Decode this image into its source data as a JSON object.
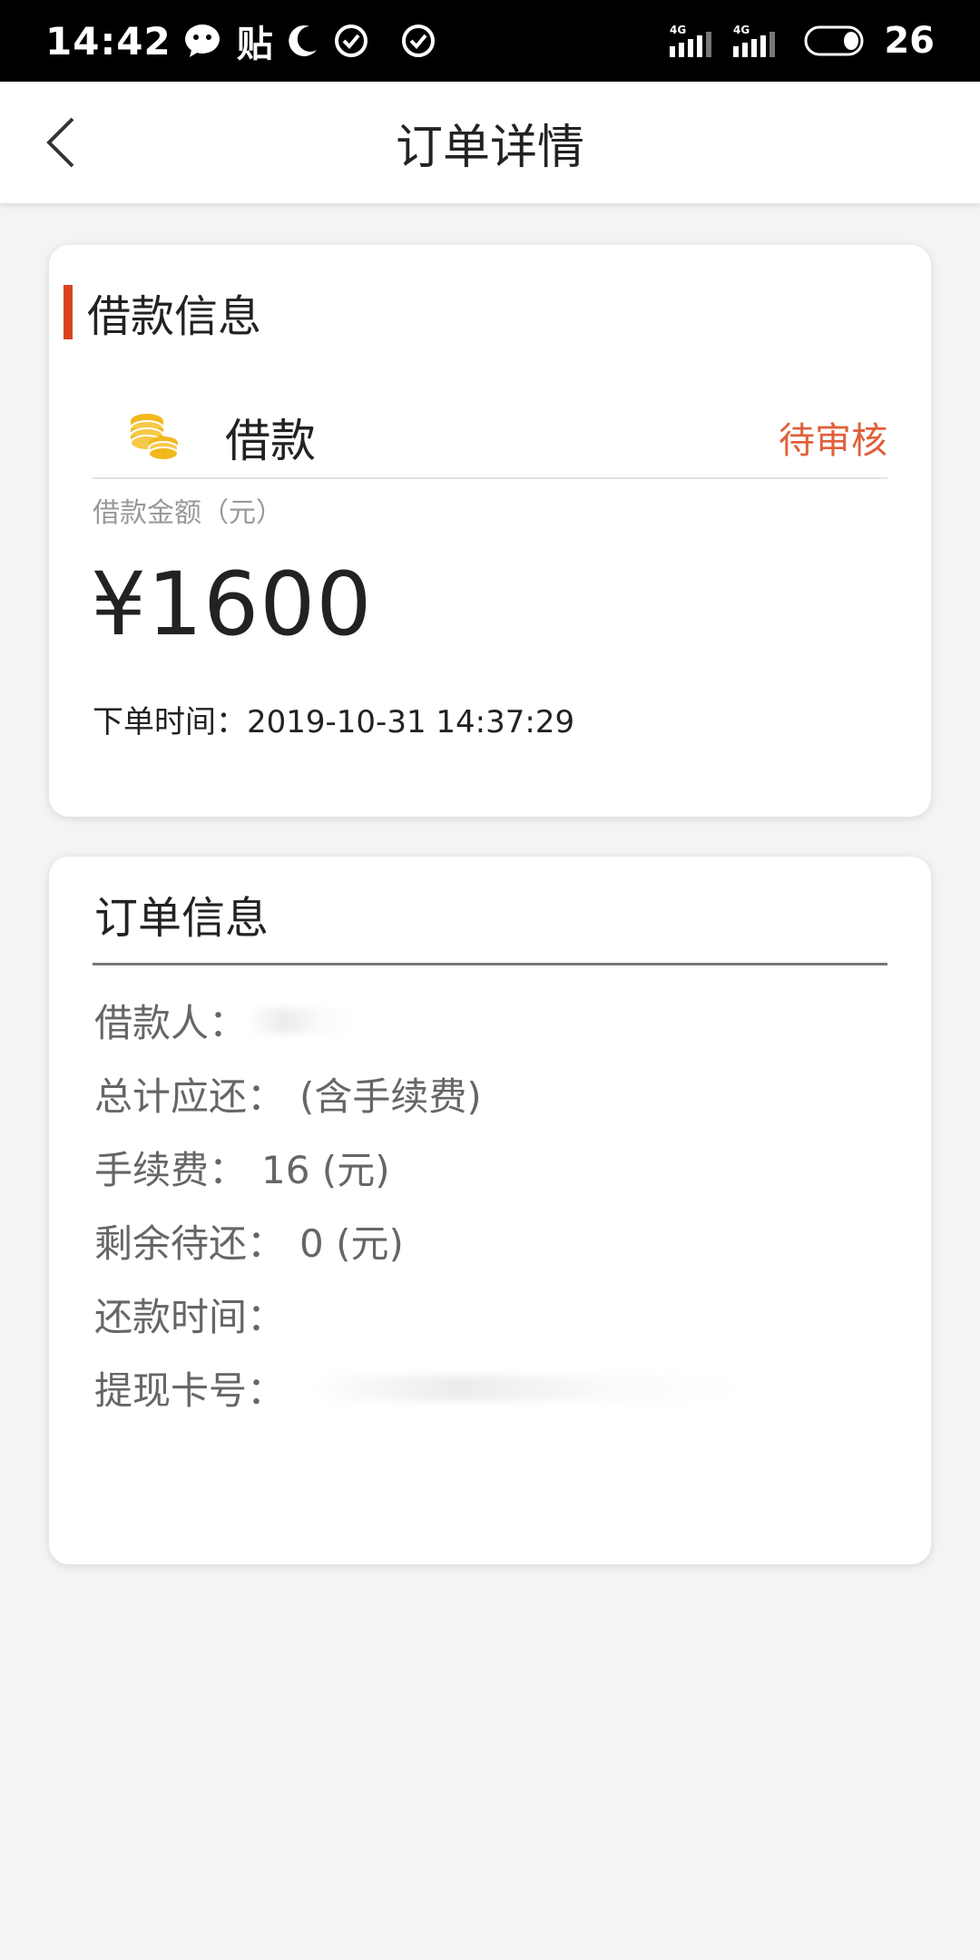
{
  "status_bar": {
    "time": "14:42",
    "app_text": "贴",
    "battery": "26",
    "network_label": "4G",
    "icons": [
      "wechat-icon",
      "moon-icon",
      "check-circle-icon",
      "check-circle-icon",
      "signal-4g-icon",
      "signal-4g-icon",
      "battery-icon"
    ]
  },
  "header": {
    "title": "订单详情"
  },
  "loan_card": {
    "section_title": "借款信息",
    "loan_type": "借款",
    "status": "待审核",
    "amount_label": "借款金额（元）",
    "amount": "¥1600",
    "order_time_label": "下单时间：",
    "order_time": "2019-10-31 14:37:29"
  },
  "order_card": {
    "section_title": "订单信息",
    "borrower_label": "借款人：",
    "total_label": "总计应还：",
    "total_value": "(含手续费)",
    "fee_label": "手续费：",
    "fee_value": "16 (元)",
    "remaining_label": "剩余待还：",
    "remaining_value": "0 (元)",
    "repay_time_label": "还款时间：",
    "card_no_label": "提现卡号："
  },
  "colors": {
    "accent": "#d9431d",
    "status_orange": "#e0603a",
    "coin_gold": "#f2b81c"
  }
}
